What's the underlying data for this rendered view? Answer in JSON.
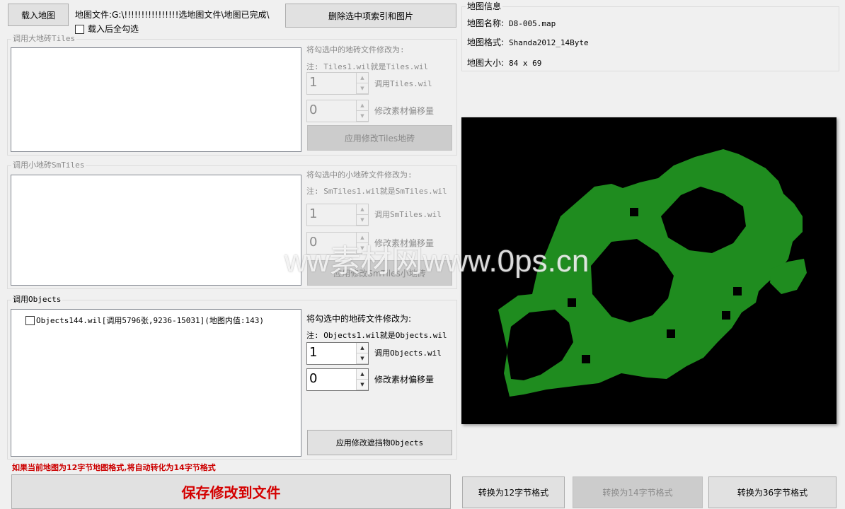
{
  "toolbar": {
    "load_map": "载入地图",
    "map_file_label": "地图文件:G:\\!!!!!!!!!!!!!!!!选地图文件\\地图已完成\\",
    "delete_selected": "删除选中项索引和图片",
    "select_all_after_load": "载入后全勾选"
  },
  "tiles": {
    "title": "调用大地砖Tiles",
    "modify_to": "将勾选中的地砖文件修改为:",
    "note": "注: Tiles1.wil就是Tiles.wil",
    "spin1_value": "1",
    "spin1_label": "调用Tiles.wil",
    "spin2_value": "0",
    "spin2_label": "修改素材偏移量",
    "apply": "应用修改Tiles地砖"
  },
  "smtiles": {
    "title": "调用小地砖SmTiles",
    "modify_to": "将勾选中的小地砖文件修改为:",
    "note": "注: SmTiles1.wil就是SmTiles.wil",
    "spin1_value": "1",
    "spin1_label": "调用SmTiles.wil",
    "spin2_value": "0",
    "spin2_label": "修改素材偏移量",
    "apply": "应用修改SmTiles小地砖"
  },
  "objects": {
    "title": "调用Objects",
    "list_item": "Objects144.wil[调用5796张,9236-15031](地图内值:143)",
    "modify_to": "将勾选中的地砖文件修改为:",
    "note": "注: Objects1.wil就是Objects.wil",
    "spin1_value": "1",
    "spin1_label": "调用Objects.wil",
    "spin2_value": "0",
    "spin2_label": "修改素材偏移量",
    "apply": "应用修改遮挡物Objects"
  },
  "warning": "如果当前地图为12字节地图格式,将自动转化为14字节格式",
  "save": "保存修改到文件",
  "map_info": {
    "title": "地图信息",
    "name_label": "地图名称:",
    "name_value": "D8-005.map",
    "format_label": "地图格式:",
    "format_value": "Shanda2012_14Byte",
    "size_label": "地图大小:",
    "size_value": "84 x 69"
  },
  "convert": {
    "to12": "转换为12字节格式",
    "to14": "转换为14字节格式",
    "to36": "转换为36字节格式"
  },
  "watermark": "ww素材网www.0ps.cn",
  "colors": {
    "map_bg": "#000000",
    "map_fill": "#1f8c1f",
    "warning": "#cc0000",
    "save_text": "#d40000"
  }
}
